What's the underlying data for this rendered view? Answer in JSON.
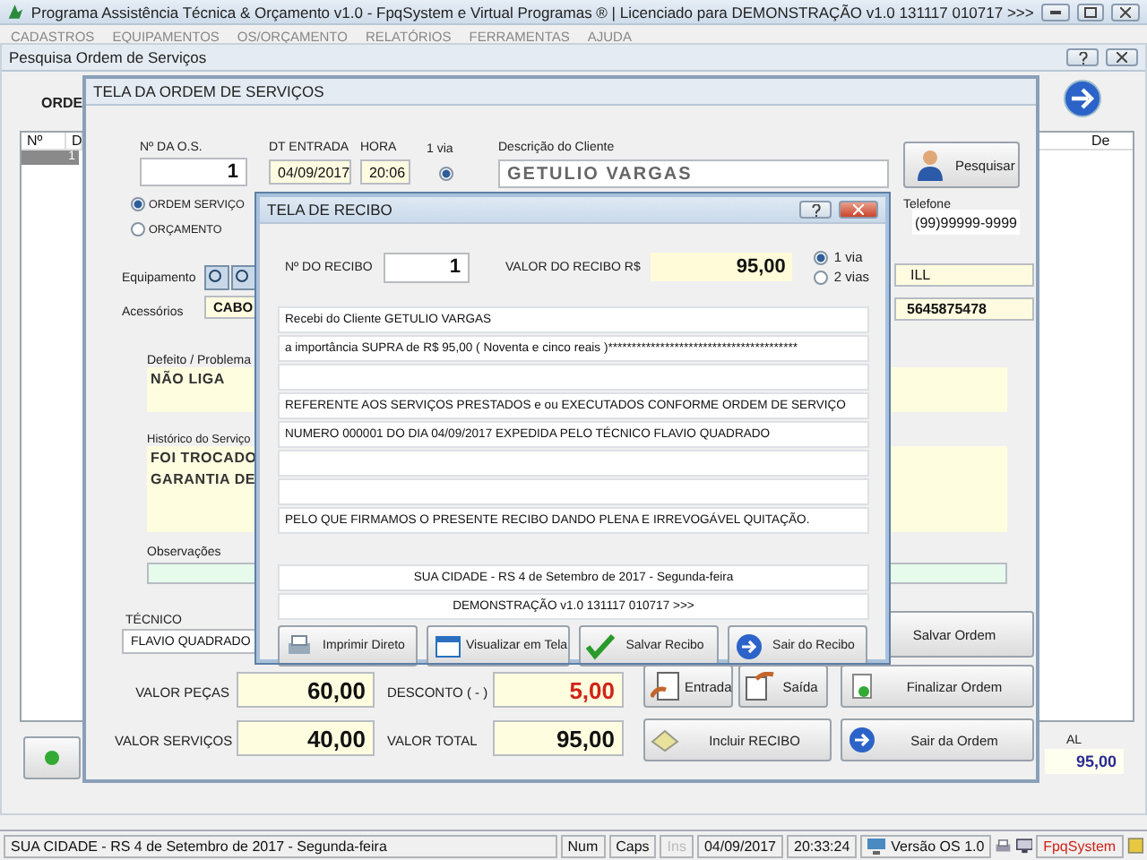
{
  "app_window": {
    "title": "Programa Assistência Técnica & Orçamento v1.0 - FpqSystem e Virtual Programas ® | Licenciado para  DEMONSTRAÇÃO v1.0 131117 010717 >>>",
    "menu": [
      "CADASTROS",
      "EQUIPAMENTOS",
      "OS/ORÇAMENTO",
      "RELATÓRIOS",
      "FERRAMENTAS",
      "AJUDA"
    ]
  },
  "search_window": {
    "title": "Pesquisa Ordem de Serviços",
    "label": "ORDE",
    "columns": [
      "Nº",
      "D",
      "De"
    ],
    "rows": [
      {
        "cells": [
          "1"
        ],
        "selected": true
      }
    ],
    "total_label": "AL",
    "total": "95,00"
  },
  "order_window": {
    "title": "TELA DA ORDEM DE SERVIÇOS",
    "os_number_label": "Nº DA O.S.",
    "os_number": "1",
    "entry_date_label": "DT ENTRADA",
    "entry_date": "04/09/2017",
    "time_label": "HORA",
    "time": "20:06",
    "copies_label": "1 via",
    "copies_checked": true,
    "order_types": [
      {
        "label": "ORDEM SERVIÇO",
        "selected": true
      },
      {
        "label": "ORÇAMENTO",
        "selected": false
      }
    ],
    "client_label": "Descrição do Cliente",
    "client": "GETULIO VARGAS",
    "search_button": "Pesquisar",
    "phone_label": "Telefone",
    "phone": "(99)99999-9999",
    "equipment_label": "Equipamento",
    "equipment": "ILL",
    "accessories_label": "Acessórios",
    "accessories": "CABO",
    "serial": "5645875478",
    "defect_label": "Defeito / Problema",
    "defect": "NÃO LIGA",
    "history_label": "Histórico do Serviço",
    "history": [
      "FOI TROCADO",
      "GARANTIA DE"
    ],
    "notes_label": "Observações",
    "technician_label": "TÉCNICO",
    "technician": "FLAVIO QUADRADO",
    "totals": [
      {
        "label": "VALOR PEÇAS",
        "value": "60,00",
        "kind": "normal"
      },
      {
        "label": "DESCONTO ( - )",
        "value": "5,00",
        "kind": "discount"
      },
      {
        "label": "VALOR SERVIÇOS",
        "value": "40,00",
        "kind": "normal"
      },
      {
        "label": "VALOR TOTAL",
        "value": "95,00",
        "kind": "normal"
      }
    ],
    "buttons": [
      {
        "label": "Salvar Ordem",
        "kind": "save"
      },
      {
        "label": "Entrada",
        "kind": "in"
      },
      {
        "label": "Saída",
        "kind": "out"
      },
      {
        "label": "Finalizar Ordem",
        "kind": "finish"
      },
      {
        "label": "Incluir RECIBO",
        "kind": "receipt"
      },
      {
        "label": "Sair da Ordem",
        "kind": "exit"
      }
    ]
  },
  "receipt_dialog": {
    "title": "TELA DE RECIBO",
    "number_label": "Nº DO RECIBO",
    "number": "1",
    "value_label": "VALOR DO RECIBO R$",
    "value": "95,00",
    "copies": [
      {
        "label": "1 via",
        "selected": true
      },
      {
        "label": "2 vias",
        "selected": false
      }
    ],
    "lines": [
      {
        "kind": "text",
        "text": "Recebi do Cliente  GETULIO VARGAS"
      },
      {
        "kind": "text",
        "text": "a importância SUPRA de R$       95,00 ( Noventa e cinco reais )****************************************"
      },
      {
        "kind": "blank"
      },
      {
        "kind": "text",
        "text": "REFERENTE AOS SERVIÇOS PRESTADOS e ou EXECUTADOS CONFORME ORDEM DE SERVIÇO"
      },
      {
        "kind": "text",
        "text": "NUMERO 000001 DO DIA 04/09/2017  EXPEDIDA PELO TÉCNICO FLAVIO QUADRADO"
      },
      {
        "kind": "blank"
      },
      {
        "kind": "blank"
      },
      {
        "kind": "text",
        "text": "PELO QUE FIRMAMOS O PRESENTE RECIBO DANDO PLENA E IRREVOGÁVEL QUITAÇÃO."
      },
      {
        "kind": "gap"
      },
      {
        "kind": "centered",
        "text": "SUA CIDADE - RS  4 de Setembro de 2017 - Segunda-feira"
      },
      {
        "kind": "centered",
        "text": "DEMONSTRAÇÃO v1.0 131117 010717 >>>"
      }
    ],
    "buttons": [
      {
        "label": "Imprimir Direto",
        "kind": "print"
      },
      {
        "label": "Visualizar em Tela",
        "kind": "view"
      },
      {
        "label": "Salvar Recibo",
        "kind": "save"
      },
      {
        "label": "Sair do Recibo",
        "kind": "exit"
      }
    ]
  },
  "status_bar": {
    "location": "SUA CIDADE - RS  4 de Setembro de 2017 - Segunda-feira",
    "keys": [
      {
        "label": "Num",
        "disabled": false
      },
      {
        "label": "Caps",
        "disabled": false
      },
      {
        "label": "Ins",
        "disabled": true
      }
    ],
    "date": "04/09/2017",
    "time": "20:33:24",
    "version": "Versão OS 1.0",
    "brand": "FpqSystem"
  }
}
